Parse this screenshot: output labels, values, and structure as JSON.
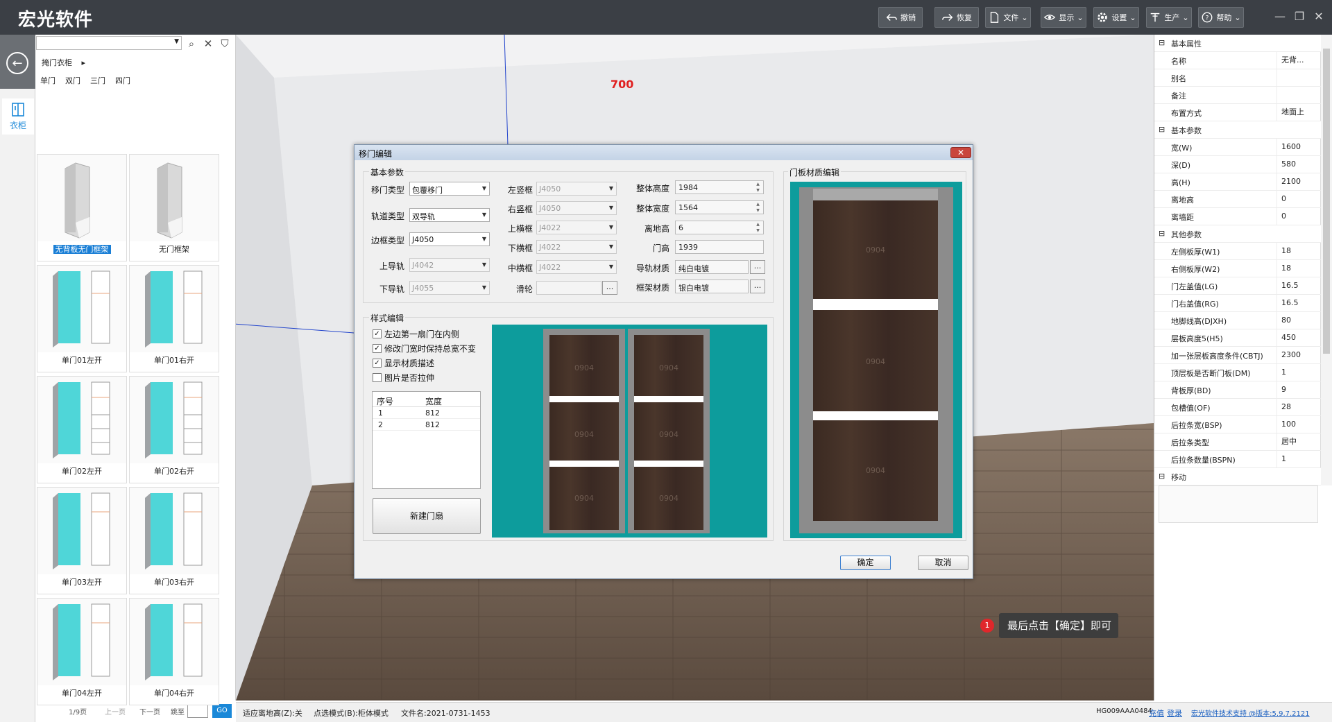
{
  "app": {
    "title": "宏光软件"
  },
  "toolbar": [
    {
      "label": "撤销",
      "icon": "undo-icon"
    },
    {
      "label": "恢复",
      "icon": "redo-icon"
    },
    {
      "label": "文件",
      "icon": "file-icon"
    },
    {
      "label": "显示",
      "icon": "eye-icon"
    },
    {
      "label": "设置",
      "icon": "gear-icon"
    },
    {
      "label": "生产",
      "icon": "production-icon"
    },
    {
      "label": "帮助",
      "icon": "help-icon"
    }
  ],
  "window_controls": [
    "—",
    "❐",
    "✕"
  ],
  "nav": {
    "item_label": "衣柜"
  },
  "left": {
    "breadcrumb": "掩门衣柜",
    "subtabs": [
      "单门",
      "双门",
      "三门",
      "四门"
    ],
    "cards": [
      "无背板无门框架",
      "无门框架",
      "单门01左开",
      "单门01右开",
      "单门02左开",
      "单门02右开",
      "单门03左开",
      "单门03右开",
      "单门04左开",
      "单门04右开"
    ],
    "pager": {
      "page": "1/9页",
      "prev": "上一页",
      "next": "下一页",
      "jump": "跳至",
      "go": "GO"
    }
  },
  "viewport": {
    "dimension_label": "700"
  },
  "status": {
    "left": [
      "适应离地高(Z):关",
      "点选模式(B):柜体模式",
      "文件名:2021-0731-1453"
    ],
    "right": {
      "id": "HG009AAA0484",
      "recharge": "充值",
      "login": "登录",
      "support": "宏光软件技术支持 @版本:5.9.7.2121"
    }
  },
  "props": {
    "groups": [
      {
        "title": "基本属性",
        "rows": [
          [
            "名称",
            "无背..."
          ],
          [
            "别名",
            ""
          ],
          [
            "备注",
            ""
          ],
          [
            "布置方式",
            "地面上"
          ]
        ]
      },
      {
        "title": "基本参数",
        "rows": [
          [
            "宽(W)",
            "1600"
          ],
          [
            "深(D)",
            "580"
          ],
          [
            "高(H)",
            "2100"
          ],
          [
            "离地高",
            "0"
          ],
          [
            "离墙距",
            "0"
          ]
        ]
      },
      {
        "title": "其他参数",
        "rows": [
          [
            "左侧板厚(W1)",
            "18"
          ],
          [
            "右侧板厚(W2)",
            "18"
          ],
          [
            "门左盖值(LG)",
            "16.5"
          ],
          [
            "门右盖值(RG)",
            "16.5"
          ],
          [
            "地脚线高(DJXH)",
            "80"
          ],
          [
            "层板高度5(H5)",
            "450"
          ],
          [
            "加一张层板高度条件(CBTJ)",
            "2300"
          ],
          [
            "顶层板是否断门板(DM)",
            "1"
          ],
          [
            "背板厚(BD)",
            "9"
          ],
          [
            "包槽值(OF)",
            "28"
          ],
          [
            "后拉条宽(BSP)",
            "100"
          ],
          [
            "后拉条类型",
            "居中"
          ],
          [
            "后拉条数量(BSPN)",
            "1"
          ]
        ]
      },
      {
        "title": "移动",
        "rows": []
      }
    ]
  },
  "dialog": {
    "title": "移门编辑",
    "close": "✕",
    "basic_group": "基本参数",
    "col1": [
      {
        "label": "移门类型",
        "value": "包覆移门"
      },
      {
        "label": "轨道类型",
        "value": "双导轨"
      },
      {
        "label": "边框类型",
        "value": "J4050"
      },
      {
        "label": "上导轨",
        "value": "J4042"
      },
      {
        "label": "下导轨",
        "value": "J4055"
      }
    ],
    "col2": [
      {
        "label": "左竖框",
        "value": "J4050"
      },
      {
        "label": "右竖框",
        "value": "J4050"
      },
      {
        "label": "上横框",
        "value": "J4022"
      },
      {
        "label": "下横框",
        "value": "J4022"
      },
      {
        "label": "中横框",
        "value": "J4022"
      },
      {
        "label": "滑轮",
        "value": ""
      }
    ],
    "col3": [
      {
        "label": "整体高度",
        "value": "1984"
      },
      {
        "label": "整体宽度",
        "value": "1564"
      },
      {
        "label": "离地高",
        "value": "6"
      },
      {
        "label": "门高",
        "value": "1939"
      },
      {
        "label": "导轨材质",
        "value": "纯白电镀"
      },
      {
        "label": "框架材质",
        "value": "银白电镀"
      }
    ],
    "style_group": "样式编辑",
    "checks": [
      {
        "label": "左边第一扇门在内侧",
        "checked": true
      },
      {
        "label": "修改门宽时保持总宽不变",
        "checked": true
      },
      {
        "label": "显示材质描述",
        "checked": true
      },
      {
        "label": "图片是否拉伸",
        "checked": false
      }
    ],
    "table": {
      "headers": [
        "序号",
        "宽度"
      ],
      "rows": [
        [
          "1",
          "812"
        ],
        [
          "2",
          "812"
        ]
      ]
    },
    "new_door": "新建门扇",
    "material_group": "门板材质编辑",
    "material_code": "0904",
    "ok": "确定",
    "cancel": "取消"
  },
  "tooltip": {
    "num": "1",
    "text": "最后点击【确定】即可"
  },
  "colors": {
    "teal": "#0d9c9c",
    "accent": "#1a7fd6",
    "topbar": "#3b3f45"
  }
}
